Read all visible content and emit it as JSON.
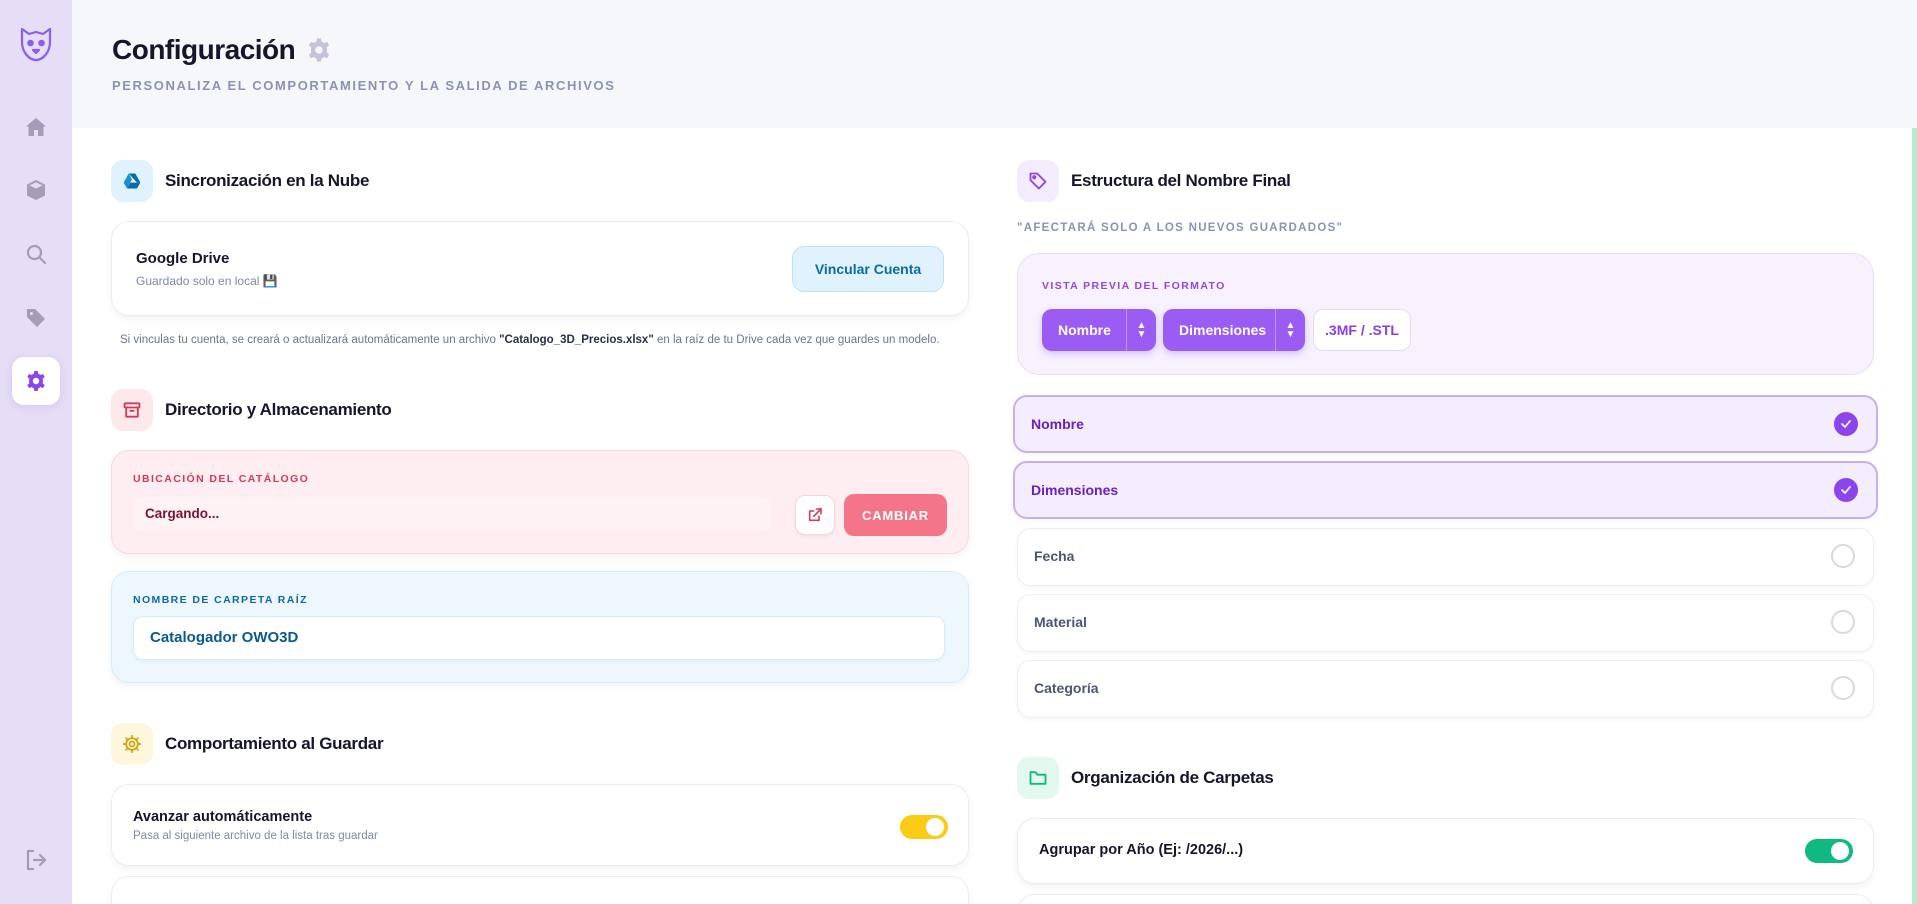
{
  "header": {
    "title": "Configuración",
    "subtitle": "PERSONALIZA EL COMPORTAMIENTO Y LA SALIDA DE ARCHIVOS"
  },
  "sidebar": {
    "items": [
      {
        "icon": "home-icon"
      },
      {
        "icon": "box-icon"
      },
      {
        "icon": "search-icon"
      },
      {
        "icon": "tag-icon"
      },
      {
        "icon": "gear-icon",
        "active": true
      }
    ],
    "logout_icon": "logout-icon"
  },
  "cloud_sync": {
    "title": "Sincronización en la Nube",
    "service_name": "Google Drive",
    "status": "Guardado solo en local 💾",
    "link_button": "Vincular Cuenta",
    "note_prefix": "Si vinculas tu cuenta, se creará o actualizará automáticamente un archivo ",
    "note_file": "\"Catalogo_3D_Precios.xlsx\"",
    "note_suffix": " en la raíz de tu Drive cada vez que guardes un modelo."
  },
  "storage": {
    "title": "Directorio y Almacenamiento",
    "location_label": "UBICACIÓN DEL CATÁLOGO",
    "location_value": "Cargando...",
    "change_button": "CAMBIAR",
    "root_label": "NOMBRE DE CARPETA RAÍZ",
    "root_value": "Catalogador OWO3D"
  },
  "save_behavior": {
    "title": "Comportamiento al Guardar",
    "rows": [
      {
        "title": "Avanzar automáticamente",
        "subtitle": "Pasa al siguiente archivo de la lista tras guardar",
        "enabled": true,
        "color": "#facc15"
      }
    ]
  },
  "name_structure": {
    "title": "Estructura del Nombre Final",
    "hint": "\"AFECTARÁ SOLO A LOS NUEVOS GUARDADOS\"",
    "preview_label": "VISTA PREVIA DEL FORMATO",
    "chips": [
      "Nombre",
      "Dimensiones"
    ],
    "extension": ".3MF / .STL",
    "options": [
      {
        "label": "Nombre",
        "selected": true
      },
      {
        "label": "Dimensiones",
        "selected": true
      },
      {
        "label": "Fecha",
        "selected": false
      },
      {
        "label": "Material",
        "selected": false
      },
      {
        "label": "Categoría",
        "selected": false
      }
    ]
  },
  "folders": {
    "title": "Organización de Carpetas",
    "rows": [
      {
        "title": "Agrupar por Año (Ej: /2026/...)",
        "enabled": true,
        "color": "#10b981"
      }
    ]
  },
  "colors": {
    "accent": "#9b5cf3",
    "sidebar": "#e6ddf6"
  }
}
